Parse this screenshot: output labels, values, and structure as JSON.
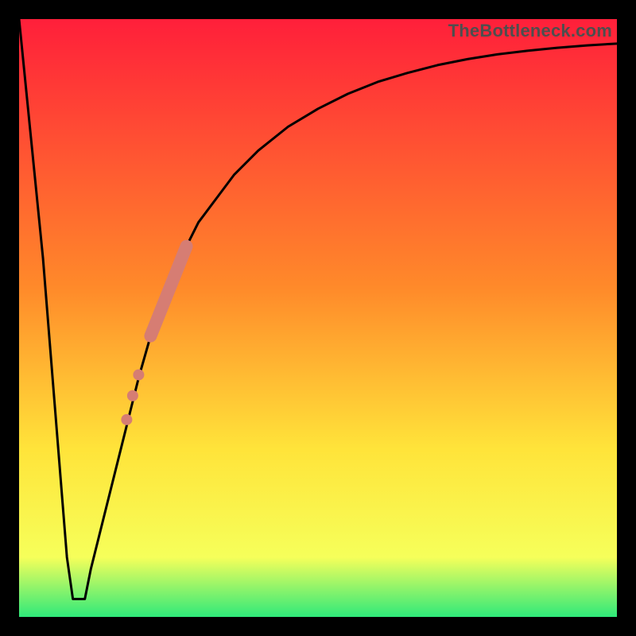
{
  "watermark": "TheBottleneck.com",
  "colors": {
    "top": "#ff1f3a",
    "mid1": "#ff8a2a",
    "mid2": "#ffe43a",
    "mid3": "#f6ff5a",
    "bottom": "#2fe97a",
    "curve": "#000000",
    "markers": "#d67d73",
    "frame": "#000000"
  },
  "chart_data": {
    "type": "line",
    "title": "",
    "xlabel": "",
    "ylabel": "",
    "xlim": [
      0,
      100
    ],
    "ylim": [
      0,
      100
    ],
    "curve": {
      "name": "bottleneck-curve",
      "x": [
        0,
        4,
        6,
        8,
        9,
        10,
        11,
        12,
        15,
        18,
        20,
        22,
        24,
        26,
        28,
        30,
        33,
        36,
        40,
        45,
        50,
        55,
        60,
        65,
        70,
        75,
        80,
        85,
        90,
        95,
        100
      ],
      "y": [
        100,
        60,
        35,
        10,
        3,
        3,
        3,
        8,
        20,
        32,
        40,
        47,
        53,
        58,
        62,
        66,
        70,
        74,
        78,
        82,
        85,
        87.5,
        89.5,
        91,
        92.3,
        93.3,
        94.1,
        94.7,
        95.2,
        95.6,
        95.9
      ]
    },
    "highlight_segment": {
      "name": "thick-marker-segment",
      "x_start": 22,
      "x_end": 28,
      "y_start": 47,
      "y_end": 62
    },
    "dots": {
      "name": "marker-dots",
      "points": [
        {
          "x": 20.0,
          "y": 40.5
        },
        {
          "x": 19.0,
          "y": 37.0
        },
        {
          "x": 18.0,
          "y": 33.0
        }
      ]
    }
  }
}
